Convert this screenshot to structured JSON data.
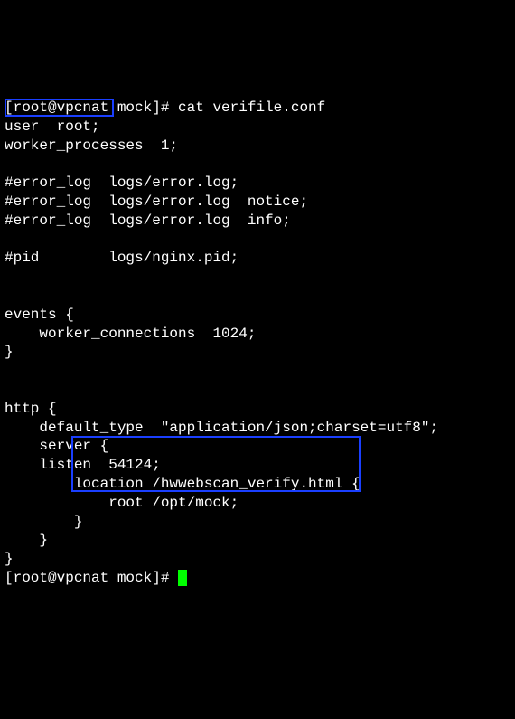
{
  "terminal": {
    "prompt1": "[root@vpcnat mock]# ",
    "command1": "cat verifile.conf",
    "lines": [
      "user  root;",
      "worker_processes  1;",
      "",
      "#error_log  logs/error.log;",
      "#error_log  logs/error.log  notice;",
      "#error_log  logs/error.log  info;",
      "",
      "#pid        logs/nginx.pid;",
      "",
      "",
      "events {",
      "    worker_connections  1024;",
      "}",
      "",
      "",
      "http {",
      "    default_type  \"application/json;charset=utf8\";",
      "    server {",
      "    listen  54124;",
      "        location /hwwebscan_verify.html {",
      "            root /opt/mock;",
      "        }",
      "    }",
      "}"
    ],
    "prompt2": "[root@vpcnat mock]# "
  }
}
